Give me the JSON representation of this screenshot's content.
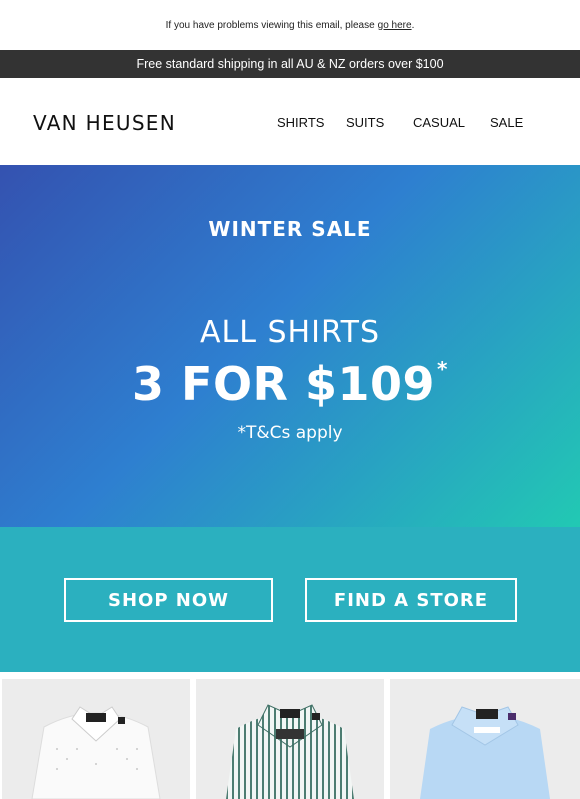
{
  "preheader": {
    "text": "If you have problems viewing this email, please",
    "link": "go here",
    "suffix": "."
  },
  "shipping_bar": {
    "text": "Free standard shipping in all AU & NZ orders over $100"
  },
  "header": {
    "logo": "VAN HEUSEN",
    "nav": [
      "SHIRTS",
      "SUITS",
      "CASUAL",
      "SALE"
    ]
  },
  "hero": {
    "kicker": "WINTER SALE",
    "line1": "ALL SHIRTS",
    "line2": "3 FOR $109",
    "asterisk": "*",
    "terms": "*T&Cs apply",
    "gradient": [
      "#3452b0",
      "#2e7fd0",
      "#22c9b3"
    ]
  },
  "cta": {
    "background": "#2bb0bf",
    "buttons": [
      "SHOP NOW",
      "FIND A STORE"
    ]
  },
  "products": [
    {
      "name": "white-dotted-shirt",
      "color": "#f4f4f4"
    },
    {
      "name": "green-striped-shirt",
      "color": "#dfe9e6"
    },
    {
      "name": "light-blue-shirt",
      "color": "#b9d9f3"
    }
  ]
}
